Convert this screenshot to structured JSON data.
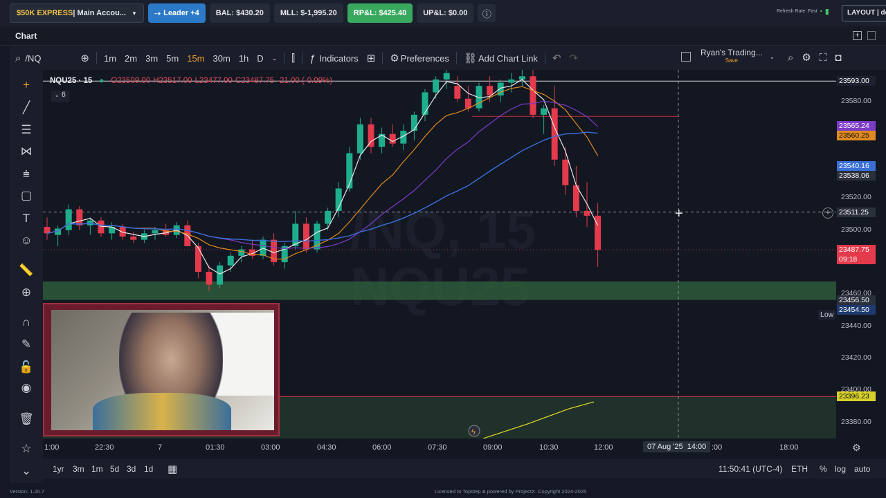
{
  "topbar": {
    "account_label_gold": "$50K EXPRESS",
    "account_label_rest": " | Main Accou...",
    "leader_label": "Leader +4",
    "bal": "BAL: $430.20",
    "mll": "MLL: $-1,995.20",
    "rpl": "RP&L: $425.40",
    "upl": "UP&L: $0.00",
    "refresh": "Refresh Rate: Fast",
    "layout": "LAYOUT | de"
  },
  "chart_tab": "Chart",
  "toolbar": {
    "symbol": "/NQ",
    "intervals": [
      "1m",
      "2m",
      "3m",
      "5m",
      "15m",
      "30m",
      "1h",
      "D"
    ],
    "active_interval": "15m",
    "indicators": "Indicators",
    "preferences": "Preferences",
    "add_chart_link": "Add Chart Link",
    "template_name": "Ryan's Trading...",
    "template_sub": "Save"
  },
  "legend": {
    "symbol": "NQU25 · 15",
    "o": "O23509.00",
    "h": "H23517.00",
    "l": "L23477.00",
    "c": "C23487.75",
    "change": "-21.00 (-0.09%)",
    "collapsed_count": "6"
  },
  "watermark": {
    "line1": "/NQ, 15",
    "line2": "NQU25"
  },
  "price_axis": {
    "labels": [
      "23580.00",
      "23520.00",
      "23500.00",
      "23460.00",
      "23440.00",
      "23420.00",
      "23400.00",
      "23380.00"
    ],
    "tags": [
      {
        "text": "23593.00",
        "color": "#1e2230"
      },
      {
        "text": "23565.24",
        "color": "#7d3cc7"
      },
      {
        "text": "23560.25",
        "color": "#e08a1e"
      },
      {
        "text": "23540.16",
        "color": "#3a6fd8"
      },
      {
        "text": "23538.06",
        "color": "#2a2f3c"
      },
      {
        "text": "23511.25",
        "color": "#2a2f3c"
      },
      {
        "text": "23487.75",
        "color": "#e33a4c"
      },
      {
        "text": "09:18",
        "color": "#e33a4c"
      },
      {
        "text": "23456.50",
        "color": "#2a2f3c"
      },
      {
        "text": "23454.50",
        "color": "#1e3a6e"
      },
      {
        "text": "23396.23",
        "color": "#d7cf2a"
      }
    ],
    "low_label": "Low"
  },
  "time_axis": {
    "labels": [
      "1:00",
      "22:30",
      "7",
      "01:30",
      "03:00",
      "04:30",
      "06:00",
      "07:30",
      "09:00",
      "10:30",
      "12:00",
      ":00",
      "18:00"
    ],
    "crosshair_label": "07 Aug '25  14:00"
  },
  "bottombar": {
    "ranges": [
      "1yr",
      "3m",
      "1m",
      "5d",
      "3d",
      "1d"
    ],
    "clock": "11:50:41 (UTC-4)",
    "session": "ETH",
    "pct": "%",
    "log": "log",
    "auto": "auto"
  },
  "footer": {
    "version": "Version: 1.20.7",
    "license": "Licensed to Topstep & powered by ProjectX. Copyright 2024-2025"
  },
  "colors": {
    "up": "#1fae8d",
    "down": "#e33a4c",
    "accent_orange": "#f0a030"
  },
  "chart_data": {
    "type": "candlestick",
    "symbol": "NQU25",
    "interval": "15",
    "ylim": [
      23370,
      23600
    ],
    "candles": [
      {
        "o": 23502,
        "h": 23508,
        "l": 23494,
        "c": 23498
      },
      {
        "o": 23497,
        "h": 23503,
        "l": 23490,
        "c": 23501
      },
      {
        "o": 23500,
        "h": 23516,
        "l": 23497,
        "c": 23513
      },
      {
        "o": 23513,
        "h": 23515,
        "l": 23500,
        "c": 23503
      },
      {
        "o": 23503,
        "h": 23508,
        "l": 23497,
        "c": 23506
      },
      {
        "o": 23506,
        "h": 23508,
        "l": 23496,
        "c": 23498
      },
      {
        "o": 23498,
        "h": 23505,
        "l": 23494,
        "c": 23502
      },
      {
        "o": 23502,
        "h": 23504,
        "l": 23494,
        "c": 23496
      },
      {
        "o": 23496,
        "h": 23499,
        "l": 23492,
        "c": 23494
      },
      {
        "o": 23494,
        "h": 23500,
        "l": 23492,
        "c": 23498
      },
      {
        "o": 23498,
        "h": 23502,
        "l": 23494,
        "c": 23500
      },
      {
        "o": 23500,
        "h": 23504,
        "l": 23496,
        "c": 23497
      },
      {
        "o": 23497,
        "h": 23505,
        "l": 23495,
        "c": 23503
      },
      {
        "o": 23503,
        "h": 23506,
        "l": 23490,
        "c": 23490
      },
      {
        "o": 23490,
        "h": 23492,
        "l": 23470,
        "c": 23474
      },
      {
        "o": 23474,
        "h": 23478,
        "l": 23462,
        "c": 23466
      },
      {
        "o": 23466,
        "h": 23480,
        "l": 23464,
        "c": 23478
      },
      {
        "o": 23478,
        "h": 23486,
        "l": 23474,
        "c": 23484
      },
      {
        "o": 23484,
        "h": 23490,
        "l": 23480,
        "c": 23488
      },
      {
        "o": 23488,
        "h": 23494,
        "l": 23482,
        "c": 23484
      },
      {
        "o": 23484,
        "h": 23496,
        "l": 23482,
        "c": 23494
      },
      {
        "o": 23494,
        "h": 23498,
        "l": 23478,
        "c": 23480
      },
      {
        "o": 23480,
        "h": 23492,
        "l": 23476,
        "c": 23490
      },
      {
        "o": 23490,
        "h": 23512,
        "l": 23488,
        "c": 23504
      },
      {
        "o": 23504,
        "h": 23508,
        "l": 23486,
        "c": 23488
      },
      {
        "o": 23488,
        "h": 23506,
        "l": 23486,
        "c": 23504
      },
      {
        "o": 23504,
        "h": 23514,
        "l": 23500,
        "c": 23512
      },
      {
        "o": 23512,
        "h": 23530,
        "l": 23508,
        "c": 23526
      },
      {
        "o": 23526,
        "h": 23552,
        "l": 23524,
        "c": 23548
      },
      {
        "o": 23548,
        "h": 23570,
        "l": 23544,
        "c": 23566
      },
      {
        "o": 23566,
        "h": 23570,
        "l": 23548,
        "c": 23552
      },
      {
        "o": 23552,
        "h": 23564,
        "l": 23548,
        "c": 23560
      },
      {
        "o": 23560,
        "h": 23566,
        "l": 23552,
        "c": 23554
      },
      {
        "o": 23554,
        "h": 23566,
        "l": 23550,
        "c": 23562
      },
      {
        "o": 23562,
        "h": 23574,
        "l": 23556,
        "c": 23572
      },
      {
        "o": 23572,
        "h": 23588,
        "l": 23568,
        "c": 23586
      },
      {
        "o": 23586,
        "h": 23596,
        "l": 23582,
        "c": 23594
      },
      {
        "o": 23594,
        "h": 23600,
        "l": 23588,
        "c": 23598
      },
      {
        "o": 23590,
        "h": 23596,
        "l": 23580,
        "c": 23582
      },
      {
        "o": 23582,
        "h": 23590,
        "l": 23574,
        "c": 23576
      },
      {
        "o": 23576,
        "h": 23592,
        "l": 23574,
        "c": 23590
      },
      {
        "o": 23590,
        "h": 23596,
        "l": 23580,
        "c": 23584
      },
      {
        "o": 23584,
        "h": 23594,
        "l": 23580,
        "c": 23592
      },
      {
        "o": 23592,
        "h": 23598,
        "l": 23586,
        "c": 23594
      },
      {
        "o": 23594,
        "h": 23600,
        "l": 23590,
        "c": 23596
      },
      {
        "o": 23596,
        "h": 23600,
        "l": 23570,
        "c": 23572
      },
      {
        "o": 23572,
        "h": 23578,
        "l": 23560,
        "c": 23576
      },
      {
        "o": 23576,
        "h": 23590,
        "l": 23540,
        "c": 23544
      },
      {
        "o": 23544,
        "h": 23552,
        "l": 23522,
        "c": 23528
      },
      {
        "o": 23528,
        "h": 23540,
        "l": 23508,
        "c": 23512
      },
      {
        "o": 23512,
        "h": 23530,
        "l": 23502,
        "c": 23509
      },
      {
        "o": 23509,
        "h": 23517,
        "l": 23477,
        "c": 23487.75
      }
    ],
    "zones": [
      {
        "from": 23456.5,
        "to": 23468,
        "color": "#2e5a3a"
      },
      {
        "from": 23370,
        "to": 23396,
        "color": "#22362c"
      }
    ],
    "lines": [
      {
        "price": 23593.0,
        "color": "#d8d8d8"
      },
      {
        "price": 23571.0,
        "color": "#c43040"
      },
      {
        "price": 23511.25,
        "color": "#9aa0aa",
        "dashed": true
      },
      {
        "price": 23487.75,
        "color": "#c43040",
        "dotted": true
      },
      {
        "price": 23396.23,
        "color": "#e33a4c"
      }
    ],
    "ylabel": "",
    "xlabel": ""
  }
}
